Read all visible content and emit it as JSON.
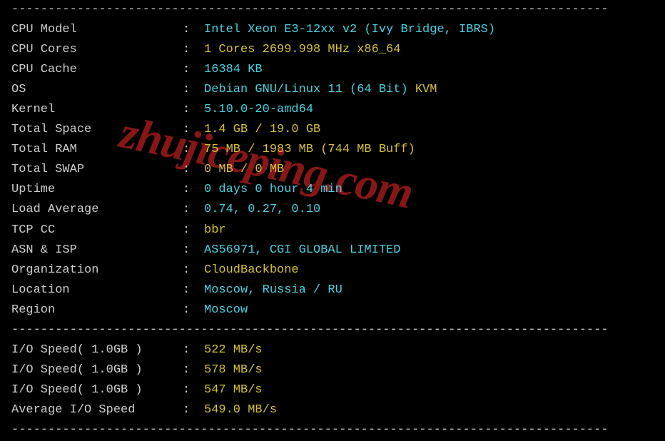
{
  "watermark": "zhujiceping.com",
  "dashline": "----------------------------------------------------------------------------------",
  "sysinfo": [
    {
      "label": "CPU Model",
      "parts": [
        {
          "text": "Intel Xeon E3-12xx v2 (Ivy Bridge, IBRS)",
          "color": "cyan"
        }
      ]
    },
    {
      "label": "CPU Cores",
      "parts": [
        {
          "text": "1 Cores 2699.998 MHz x86_64",
          "color": "yellow"
        }
      ]
    },
    {
      "label": "CPU Cache",
      "parts": [
        {
          "text": "16384 KB",
          "color": "cyan"
        }
      ]
    },
    {
      "label": "OS",
      "parts": [
        {
          "text": "Debian GNU/Linux 11 (64 Bit) ",
          "color": "cyan"
        },
        {
          "text": "KVM",
          "color": "yellow"
        }
      ]
    },
    {
      "label": "Kernel",
      "parts": [
        {
          "text": "5.10.0-20-amd64",
          "color": "cyan"
        }
      ]
    },
    {
      "label": "Total Space",
      "parts": [
        {
          "text": "1.4 GB / 19.0 GB",
          "color": "yellow"
        }
      ]
    },
    {
      "label": "Total RAM",
      "parts": [
        {
          "text": "75 MB / 1983 MB (744 MB Buff)",
          "color": "yellow"
        }
      ]
    },
    {
      "label": "Total SWAP",
      "parts": [
        {
          "text": "0 MB / 0 MB",
          "color": "yellow"
        }
      ]
    },
    {
      "label": "Uptime",
      "parts": [
        {
          "text": "0 days 0 hour 4 min",
          "color": "cyan"
        }
      ]
    },
    {
      "label": "Load Average",
      "parts": [
        {
          "text": "0.74, 0.27, 0.10",
          "color": "cyan"
        }
      ]
    },
    {
      "label": "TCP CC",
      "parts": [
        {
          "text": "bbr",
          "color": "yellow"
        }
      ]
    },
    {
      "label": "ASN & ISP",
      "parts": [
        {
          "text": "AS56971, CGI GLOBAL LIMITED",
          "color": "cyan"
        }
      ]
    },
    {
      "label": "Organization",
      "parts": [
        {
          "text": "CloudBackbone",
          "color": "yellow"
        }
      ]
    },
    {
      "label": "Location",
      "parts": [
        {
          "text": "Moscow, Russia / RU",
          "color": "cyan"
        }
      ]
    },
    {
      "label": "Region",
      "parts": [
        {
          "text": "Moscow",
          "color": "cyan"
        }
      ]
    }
  ],
  "iospeed": [
    {
      "label": "I/O Speed( 1.0GB )",
      "parts": [
        {
          "text": "522 MB/s",
          "color": "yellow"
        }
      ]
    },
    {
      "label": "I/O Speed( 1.0GB )",
      "parts": [
        {
          "text": "578 MB/s",
          "color": "yellow"
        }
      ]
    },
    {
      "label": "I/O Speed( 1.0GB )",
      "parts": [
        {
          "text": "547 MB/s",
          "color": "yellow"
        }
      ]
    },
    {
      "label": "Average I/O Speed",
      "parts": [
        {
          "text": "549.0 MB/s",
          "color": "yellow"
        }
      ]
    }
  ]
}
